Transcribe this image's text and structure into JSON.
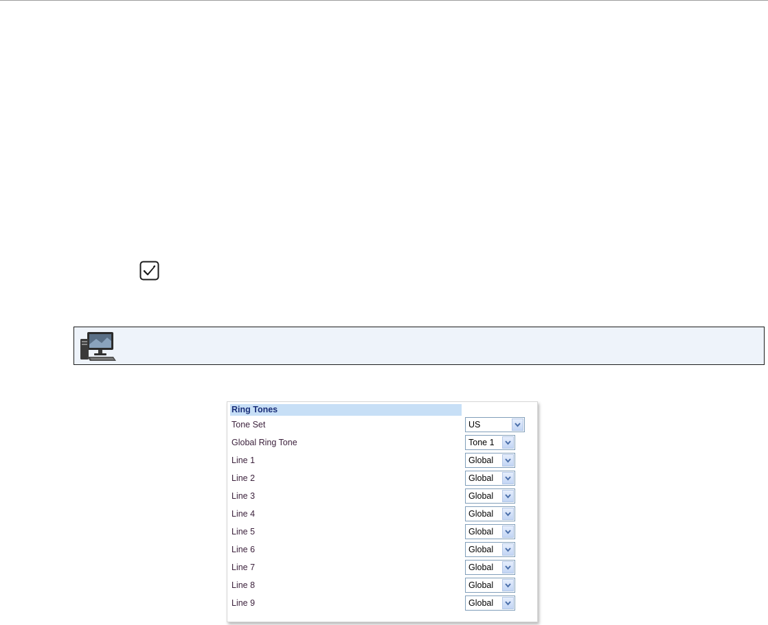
{
  "panel": {
    "title": "Ring Tones",
    "rows": [
      {
        "label": "Tone Set",
        "value": "US"
      },
      {
        "label": "Global Ring Tone",
        "value": "Tone 1"
      },
      {
        "label": "Line 1",
        "value": "Global"
      },
      {
        "label": "Line 2",
        "value": "Global"
      },
      {
        "label": "Line 3",
        "value": "Global"
      },
      {
        "label": "Line 4",
        "value": "Global"
      },
      {
        "label": "Line 5",
        "value": "Global"
      },
      {
        "label": "Line 6",
        "value": "Global"
      },
      {
        "label": "Line 7",
        "value": "Global"
      },
      {
        "label": "Line 8",
        "value": "Global"
      },
      {
        "label": "Line 9",
        "value": "Global"
      }
    ]
  },
  "icons": {
    "step_check": "checkbox-checked-icon",
    "note_computer": "computer-monitor-icon"
  },
  "colors": {
    "header_bg": "#c7dff6",
    "header_text": "#1a2f7a",
    "note_bg": "#eef3fa",
    "select_border": "#7f9db9"
  }
}
